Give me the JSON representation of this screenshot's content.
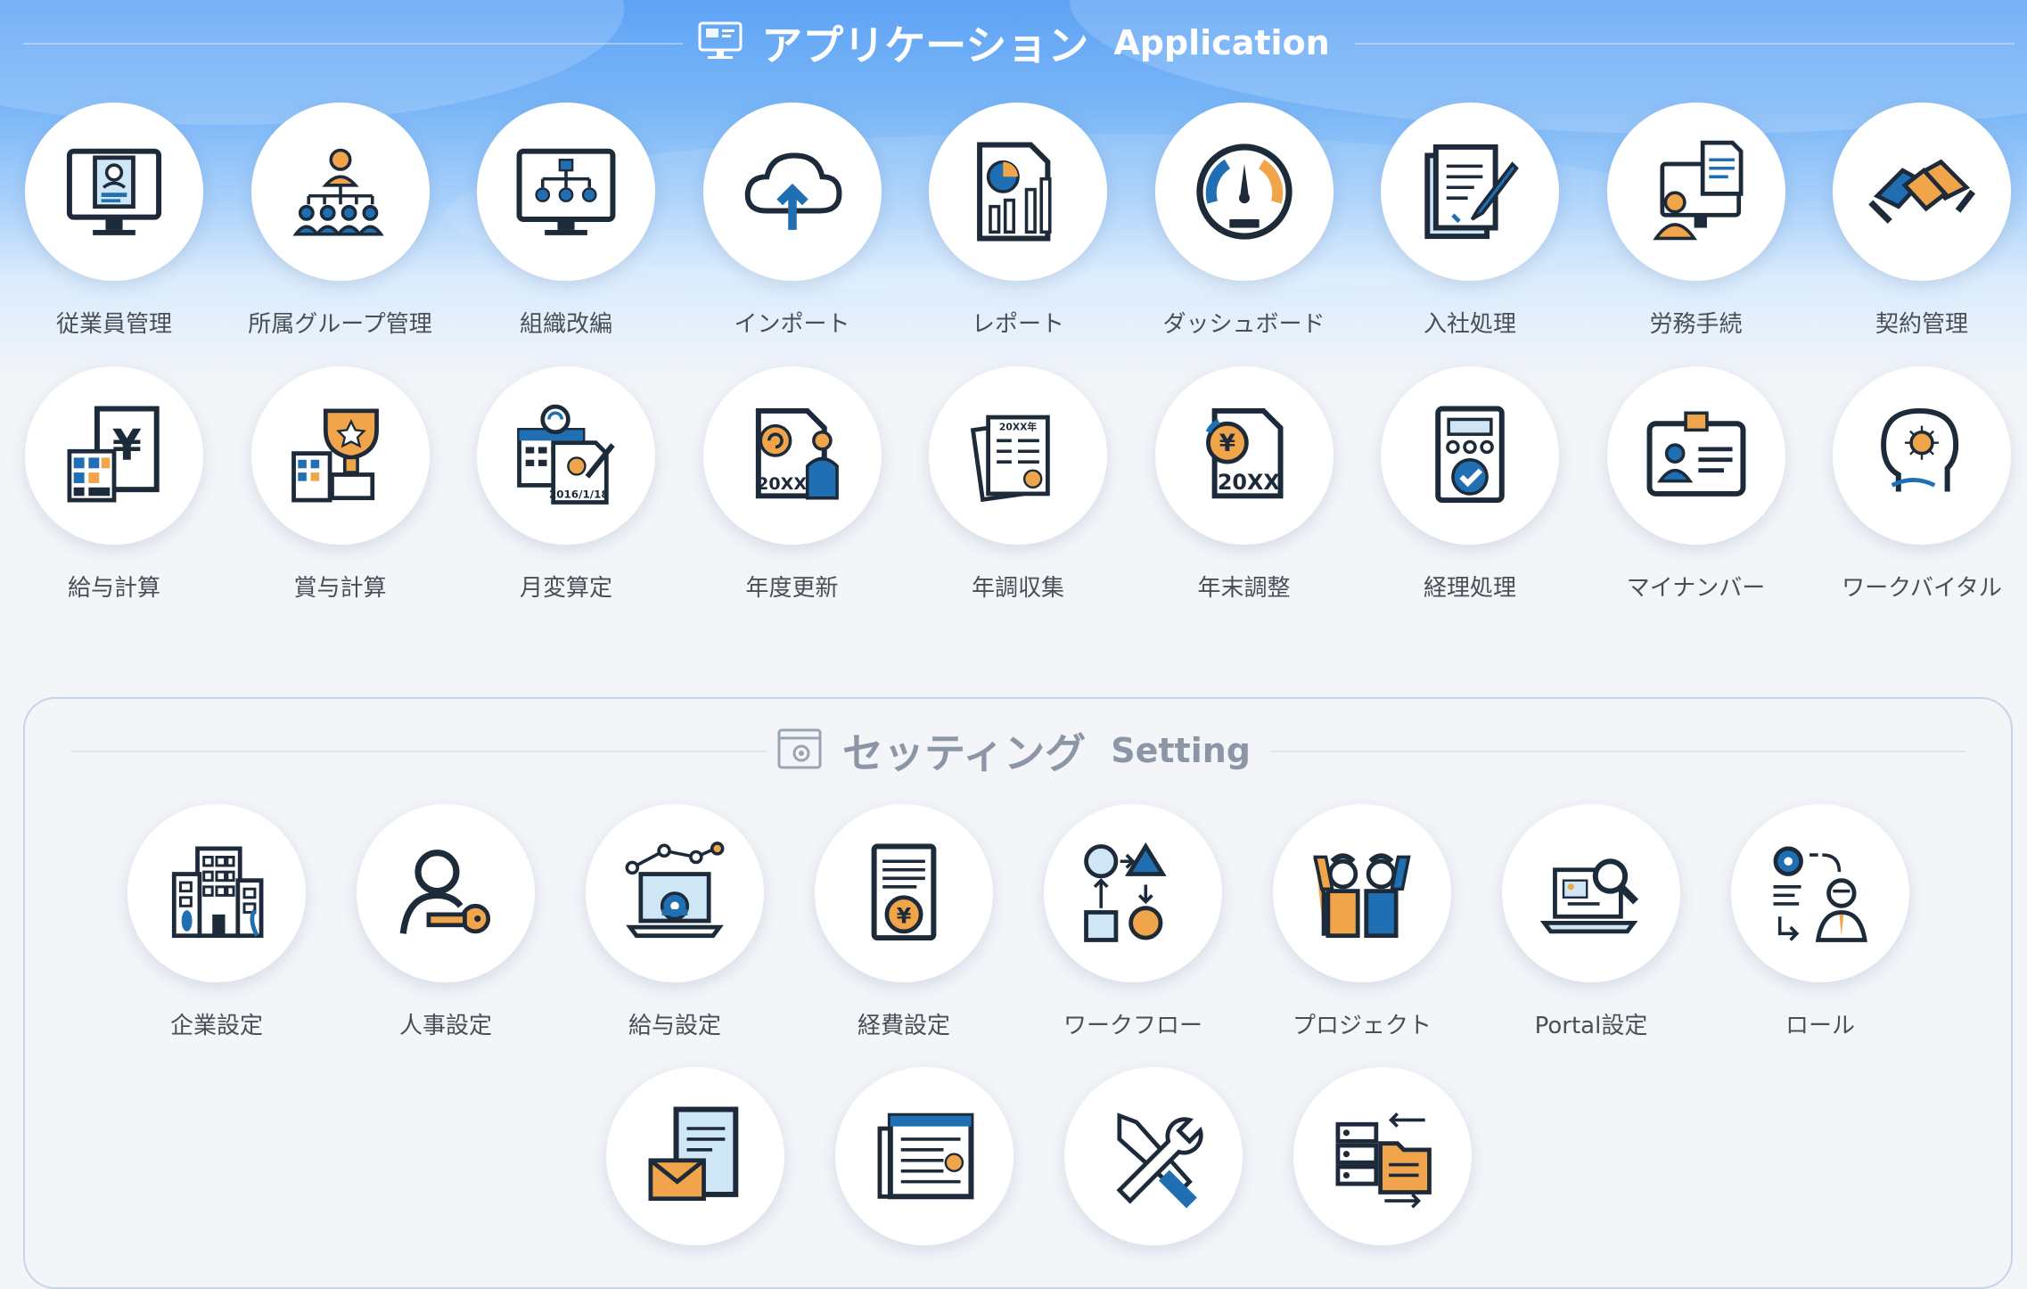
{
  "application": {
    "title_jp": "アプリケーション",
    "title_en": "Application",
    "header_icon": "monitor-icon",
    "items": [
      {
        "label": "従業員管理",
        "icon": "employee-profile-monitor-icon"
      },
      {
        "label": "所属グループ管理",
        "icon": "group-hierarchy-icon"
      },
      {
        "label": "組織改編",
        "icon": "org-chart-monitor-icon"
      },
      {
        "label": "インポート",
        "icon": "cloud-upload-icon"
      },
      {
        "label": "レポート",
        "icon": "report-chart-icon"
      },
      {
        "label": "ダッシュボード",
        "icon": "gauge-icon"
      },
      {
        "label": "入社処理",
        "icon": "contract-sign-icon"
      },
      {
        "label": "労務手続",
        "icon": "labor-procedure-icon"
      },
      {
        "label": "契約管理",
        "icon": "handshake-icon"
      },
      {
        "label": "給与計算",
        "icon": "payroll-calculator-icon"
      },
      {
        "label": "賞与計算",
        "icon": "bonus-trophy-icon"
      },
      {
        "label": "月変算定",
        "icon": "calendar-refresh-icon"
      },
      {
        "label": "年度更新",
        "icon": "yearly-update-icon"
      },
      {
        "label": "年調収集",
        "icon": "document-stack-icon"
      },
      {
        "label": "年末調整",
        "icon": "year-end-yen-icon"
      },
      {
        "label": "経理処理",
        "icon": "accounting-check-icon"
      },
      {
        "label": "マイナンバー",
        "icon": "id-card-icon"
      },
      {
        "label": "ワークバイタル",
        "icon": "head-mind-icon"
      }
    ]
  },
  "settings": {
    "title_jp": "セッティング",
    "title_en": "Setting",
    "header_icon": "settings-window-icon",
    "items": [
      {
        "label": "企業設定",
        "icon": "building-icon"
      },
      {
        "label": "人事設定",
        "icon": "user-key-icon"
      },
      {
        "label": "給与設定",
        "icon": "laptop-gear-icon"
      },
      {
        "label": "経費設定",
        "icon": "expense-yen-gear-icon"
      },
      {
        "label": "ワークフロー",
        "icon": "workflow-shapes-icon"
      },
      {
        "label": "プロジェクト",
        "icon": "team-celebrate-icon"
      },
      {
        "label": "Portal設定",
        "icon": "laptop-search-icon"
      },
      {
        "label": "ロール",
        "icon": "role-person-icon"
      },
      {
        "label": "",
        "icon": "mail-document-icon"
      },
      {
        "label": "",
        "icon": "newspaper-icon"
      },
      {
        "label": "",
        "icon": "tools-wrench-icon"
      },
      {
        "label": "",
        "icon": "data-transfer-icon"
      }
    ]
  },
  "colors": {
    "navy": "#1c2a3a",
    "blue": "#1f6fb2",
    "orange": "#f0a54a",
    "light_blue": "#cfe6f7",
    "header_gradient_top": "#5fa3f5"
  }
}
